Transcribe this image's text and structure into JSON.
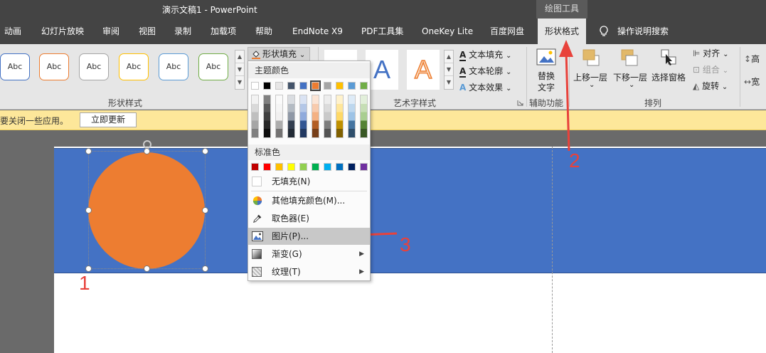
{
  "titlebar": {
    "title": "演示文稿1  -  PowerPoint",
    "context_group": "绘图工具"
  },
  "tabs": [
    "动画",
    "幻灯片放映",
    "审阅",
    "视图",
    "录制",
    "加载项",
    "帮助",
    "EndNote X9",
    "PDF工具集",
    "OneKey Lite",
    "百度网盘",
    "形状格式",
    "操作说明搜索"
  ],
  "ribbon": {
    "shape_styles": {
      "label": "形状样式",
      "gallery_item_text": "Abc",
      "gallery_colors": [
        "#4472c4",
        "#ed7d31",
        "#a5a5a5",
        "#ffc000",
        "#5b9bd5",
        "#70ad47"
      ],
      "fill_button": "形状填充",
      "fill_caret": "⌄"
    },
    "wordart": {
      "label": "艺术字样式",
      "letter": "A",
      "text_fill": "文本填充",
      "text_outline": "文本轮廓",
      "text_effects": "文本效果",
      "caret": "⌄"
    },
    "accessibility": {
      "label": "辅助功能",
      "alt_text_line1": "替换",
      "alt_text_line2": "文字"
    },
    "arrange": {
      "label": "排列",
      "bring_forward": "上移一层",
      "send_backward": "下移一层",
      "selection_pane": "选择窗格",
      "align": "对齐",
      "group": "组合",
      "rotate": "旋转",
      "caret": "⌄"
    },
    "right_cut_1": "高",
    "right_cut_2": "宽"
  },
  "notification": {
    "message": "要关闭一些应用。",
    "button": "立即更新"
  },
  "menu": {
    "theme_colors_title": "主题颜色",
    "theme_top": [
      "#ffffff",
      "#000000",
      "#e7e6e6",
      "#44546a",
      "#4472c4",
      "#ed7d31",
      "#a5a5a5",
      "#ffc000",
      "#5b9bd5",
      "#70ad47"
    ],
    "standard_colors_title": "标准色",
    "standard_colors": [
      "#c00000",
      "#ff0000",
      "#ffc000",
      "#ffff00",
      "#92d050",
      "#00b050",
      "#00b0f0",
      "#0070c0",
      "#002060",
      "#7030a0"
    ],
    "no_fill": "无填充(N)",
    "more_colors": "其他填充颜色(M)...",
    "eyedropper": "取色器(E)",
    "picture": "图片(P)...",
    "gradient": "渐变(G)",
    "texture": "纹理(T)",
    "submenu_arrow": "▶"
  },
  "annotations": [
    "1",
    "2",
    "3"
  ],
  "colors": {
    "slide_band": "#4472c4",
    "shape_fill": "#ed7d31",
    "annotation_red": "#e8423b"
  }
}
